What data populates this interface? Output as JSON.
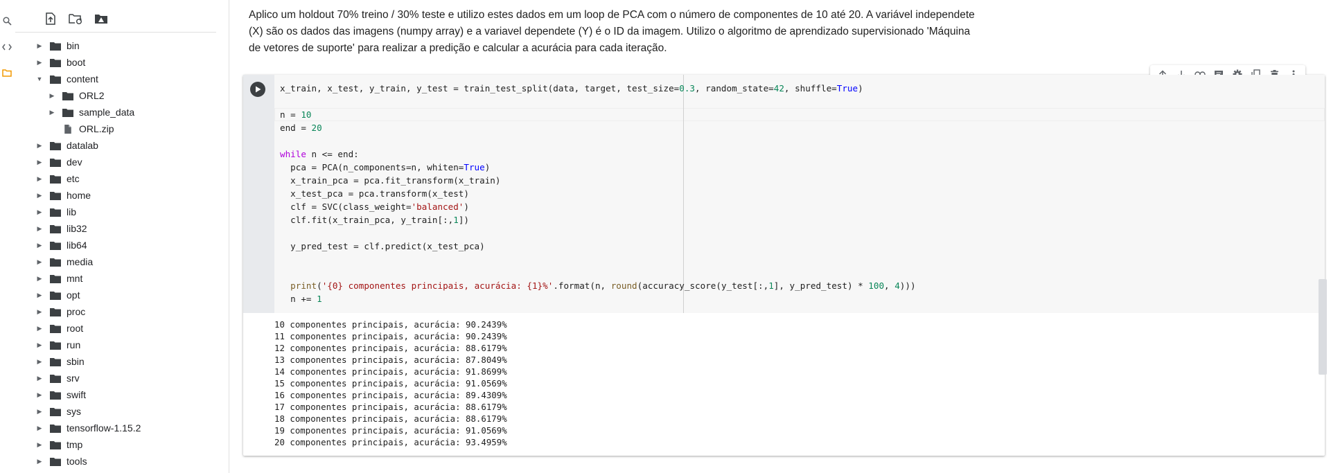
{
  "files": {
    "tree": [
      {
        "label": "bin",
        "depth": 0,
        "expanded": false,
        "type": "folder"
      },
      {
        "label": "boot",
        "depth": 0,
        "expanded": false,
        "type": "folder"
      },
      {
        "label": "content",
        "depth": 0,
        "expanded": true,
        "type": "folder"
      },
      {
        "label": "ORL2",
        "depth": 1,
        "expanded": false,
        "type": "folder"
      },
      {
        "label": "sample_data",
        "depth": 1,
        "expanded": false,
        "type": "folder"
      },
      {
        "label": "ORL.zip",
        "depth": 1,
        "expanded": false,
        "type": "file"
      },
      {
        "label": "datalab",
        "depth": 0,
        "expanded": false,
        "type": "folder"
      },
      {
        "label": "dev",
        "depth": 0,
        "expanded": false,
        "type": "folder"
      },
      {
        "label": "etc",
        "depth": 0,
        "expanded": false,
        "type": "folder"
      },
      {
        "label": "home",
        "depth": 0,
        "expanded": false,
        "type": "folder"
      },
      {
        "label": "lib",
        "depth": 0,
        "expanded": false,
        "type": "folder"
      },
      {
        "label": "lib32",
        "depth": 0,
        "expanded": false,
        "type": "folder"
      },
      {
        "label": "lib64",
        "depth": 0,
        "expanded": false,
        "type": "folder"
      },
      {
        "label": "media",
        "depth": 0,
        "expanded": false,
        "type": "folder"
      },
      {
        "label": "mnt",
        "depth": 0,
        "expanded": false,
        "type": "folder"
      },
      {
        "label": "opt",
        "depth": 0,
        "expanded": false,
        "type": "folder"
      },
      {
        "label": "proc",
        "depth": 0,
        "expanded": false,
        "type": "folder"
      },
      {
        "label": "root",
        "depth": 0,
        "expanded": false,
        "type": "folder"
      },
      {
        "label": "run",
        "depth": 0,
        "expanded": false,
        "type": "folder"
      },
      {
        "label": "sbin",
        "depth": 0,
        "expanded": false,
        "type": "folder"
      },
      {
        "label": "srv",
        "depth": 0,
        "expanded": false,
        "type": "folder"
      },
      {
        "label": "swift",
        "depth": 0,
        "expanded": false,
        "type": "folder"
      },
      {
        "label": "sys",
        "depth": 0,
        "expanded": false,
        "type": "folder"
      },
      {
        "label": "tensorflow-1.15.2",
        "depth": 0,
        "expanded": false,
        "type": "folder"
      },
      {
        "label": "tmp",
        "depth": 0,
        "expanded": false,
        "type": "folder"
      },
      {
        "label": "tools",
        "depth": 0,
        "expanded": false,
        "type": "folder"
      }
    ]
  },
  "markdown": {
    "text": "Aplico um holdout 70% treino / 30% teste e utilizo estes dados em um loop de PCA com o número de componentes de 10 até 20. A variável independete (X) são os dados das imagens (numpy array) e a variavel dependete (Y) é o ID da imagem. Utilizo o algoritmo de aprendizado supervisionado 'Máquina de vetores de suporte' para realizar a predição e calcular a acurácia para cada iteração."
  },
  "cell": {
    "code": [
      "x_train, x_test, y_train, y_test = train_test_split(data, target, test_size=0.3, random_state=42, shuffle=True)",
      "",
      "n = 10",
      "end = 20",
      "",
      "while n <= end:",
      "  pca = PCA(n_components=n, whiten=True)",
      "  x_train_pca = pca.fit_transform(x_train)",
      "  x_test_pca = pca.transform(x_test)",
      "  clf = SVC(class_weight='balanced')",
      "  clf.fit(x_train_pca, y_train[:,1])",
      "",
      "  y_pred_test = clf.predict(x_test_pca)",
      "",
      "",
      "  print('{0} componentes principais, acurácia: {1}%'.format(n, round(accuracy_score(y_test[:,1], y_pred_test) * 100, 4)))",
      "  n += 1"
    ],
    "output": [
      "10 componentes principais, acurácia: 90.2439%",
      "11 componentes principais, acurácia: 90.2439%",
      "12 componentes principais, acurácia: 88.6179%",
      "13 componentes principais, acurácia: 87.8049%",
      "14 componentes principais, acurácia: 91.8699%",
      "15 componentes principais, acurácia: 91.0569%",
      "16 componentes principais, acurácia: 89.4309%",
      "17 componentes principais, acurácia: 88.6179%",
      "18 componentes principais, acurácia: 88.6179%",
      "19 componentes principais, acurácia: 91.0569%",
      "20 componentes principais, acurácia: 93.4959%"
    ]
  },
  "icons": {
    "rail": [
      "search-icon",
      "code-icon",
      "folder-icon"
    ],
    "files_toolbar": [
      "upload-icon",
      "refresh-folder-icon",
      "drive-icon"
    ],
    "cell_toolbar": [
      "arrow-up-icon",
      "arrow-down-icon",
      "link-icon",
      "comment-icon",
      "gear-icon",
      "mirror-cell-icon",
      "delete-icon",
      "more-vert-icon"
    ]
  },
  "colors": {
    "keyword": "#0000ff",
    "control": "#af00db",
    "number": "#098658",
    "string": "#a31515",
    "folder_accent": "#f29900"
  }
}
